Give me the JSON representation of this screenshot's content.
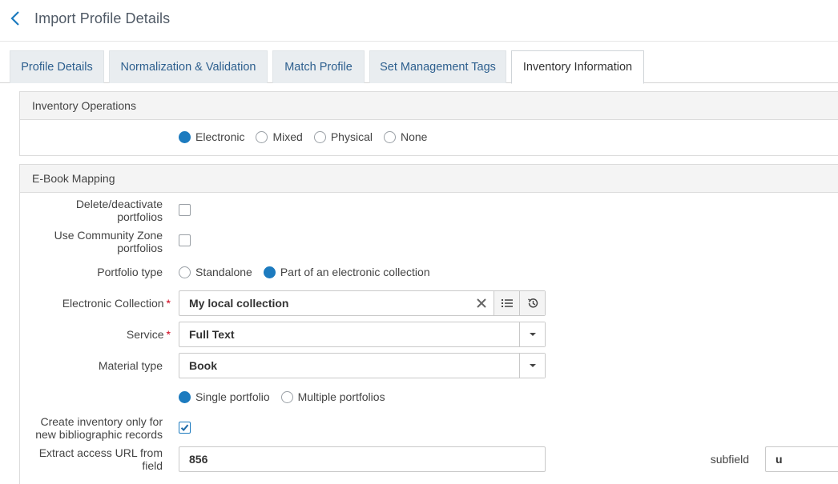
{
  "header": {
    "title": "Import Profile Details",
    "back_icon": "chevron-left-icon"
  },
  "tabs": [
    {
      "label": "Profile Details",
      "active": false
    },
    {
      "label": "Normalization & Validation",
      "active": false
    },
    {
      "label": "Match Profile",
      "active": false
    },
    {
      "label": "Set Management Tags",
      "active": false
    },
    {
      "label": "Inventory Information",
      "active": true
    }
  ],
  "inventory_operations": {
    "title": "Inventory Operations",
    "options": [
      "Electronic",
      "Mixed",
      "Physical",
      "None"
    ],
    "selected": "Electronic"
  },
  "ebook_mapping": {
    "title": "E-Book Mapping",
    "delete_portfolios": {
      "label_line1": "Delete/deactivate",
      "label_line2": "portfolios",
      "checked": false
    },
    "community_zone": {
      "label_line1": "Use Community Zone",
      "label_line2": "portfolios",
      "checked": false
    },
    "portfolio_type": {
      "label": "Portfolio type",
      "options": [
        "Standalone",
        "Part of an electronic collection"
      ],
      "selected": "Part of an electronic collection"
    },
    "electronic_collection": {
      "label": "Electronic Collection",
      "required_mark": "*",
      "value": "My local collection"
    },
    "service": {
      "label": "Service",
      "required_mark": "*",
      "value": "Full Text"
    },
    "material_type": {
      "label": "Material type",
      "value": "Book"
    },
    "portfolio_count": {
      "options": [
        "Single portfolio",
        "Multiple portfolios"
      ],
      "selected": "Single portfolio"
    },
    "create_inventory": {
      "label_line1": "Create inventory only for",
      "label_line2": "new bibliographic records",
      "checked": true
    },
    "extract_url": {
      "label_line1": "Extract access URL from",
      "label_line2": "field",
      "value": "856"
    },
    "subfield": {
      "label": "subfield",
      "value": "u"
    }
  },
  "colors": {
    "accent": "#1d7bbf",
    "tab_bg": "#e9edf0",
    "tab_text": "#2d5f8e",
    "required": "#d0021b"
  }
}
